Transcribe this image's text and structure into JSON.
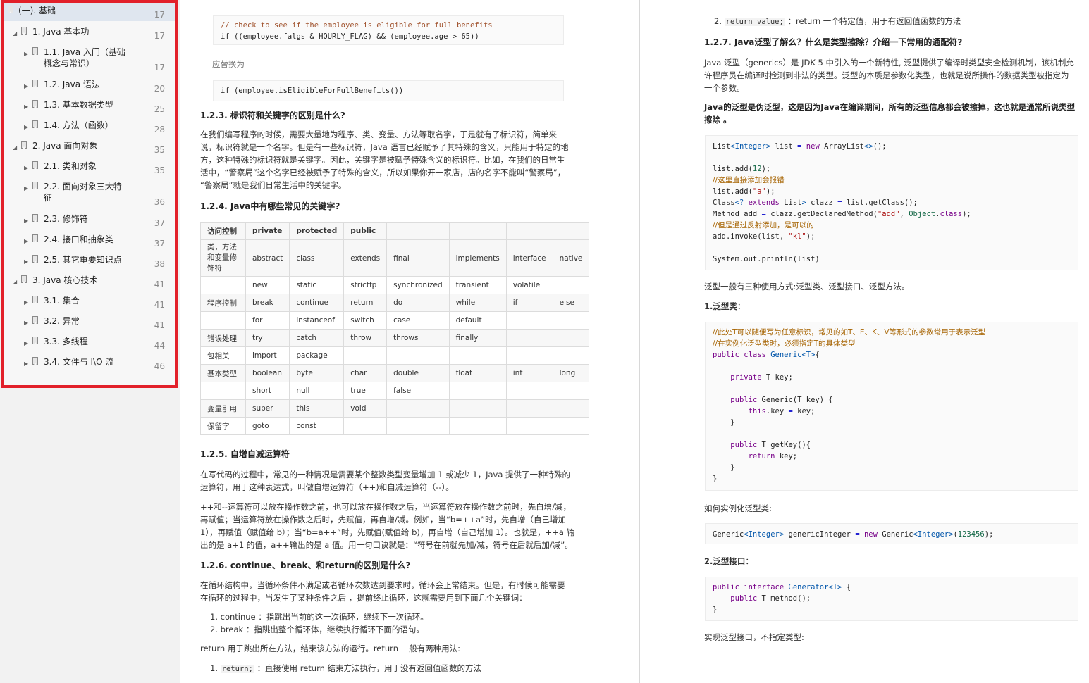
{
  "outline": {
    "items": [
      {
        "label": "(一). 基础",
        "page": "17",
        "level": 0,
        "expanded": true
      },
      {
        "label": "1. Java 基本功",
        "page": "17",
        "level": 1,
        "expanded": true
      },
      {
        "label": "1.1. Java 入门（基础",
        "label2": "概念与常识）",
        "page": "17",
        "level": 2
      },
      {
        "label": "1.2. Java 语法",
        "page": "20",
        "level": 2
      },
      {
        "label": "1.3. 基本数据类型",
        "page": "25",
        "level": 2
      },
      {
        "label": "1.4. 方法（函数）",
        "page": "28",
        "level": 2
      },
      {
        "label": "2. Java 面向对象",
        "page": "35",
        "level": 1,
        "expanded": true
      },
      {
        "label": "2.1. 类和对象",
        "page": "35",
        "level": 2
      },
      {
        "label": "2.2. 面向对象三大特",
        "label2": "征",
        "page": "36",
        "level": 2
      },
      {
        "label": "2.3. 修饰符",
        "page": "37",
        "level": 2
      },
      {
        "label": "2.4. 接口和抽象类",
        "page": "37",
        "level": 2
      },
      {
        "label": "2.5. 其它重要知识点",
        "page": "38",
        "level": 2
      },
      {
        "label": "3. Java 核心技术",
        "page": "41",
        "level": 1,
        "expanded": true
      },
      {
        "label": "3.1. 集合",
        "page": "41",
        "level": 2
      },
      {
        "label": "3.2. 异常",
        "page": "41",
        "level": 2
      },
      {
        "label": "3.3. 多线程",
        "page": "44",
        "level": 2
      },
      {
        "label": "3.4. 文件与 I\\O 流",
        "page": "46",
        "level": 2
      }
    ]
  },
  "left": {
    "code1_comment": "// check to see if the employee is eligible for full benefits",
    "code1_line2": "if ((employee.falgs & HOURLY_FLAG) && (employee.age > 65))",
    "replace_label": "应替换为",
    "code2": "if (employee.isEligibleForFullBenefits())",
    "h123": "1.2.3. 标识符和关键字的区别是什么?",
    "p123": [
      "在我们编写程序的时候，需要大量地为程序、类、变量、方法等取名字，于是就有了标识符，简单来",
      "说，标识符就是一个名字。但是有一些标识符，Java 语言已经赋予了其特殊的含义，只能用于特定的地",
      "方，这种特殊的标识符就是关键字。因此，关键字是被赋予特殊含义的标识符。比如，在我们的日常生",
      "活中，“警察局”这个名字已经被赋予了特殊的含义，所以如果你开一家店，店的名字不能叫“警察局”，",
      "“警察局”就是我们日常生活中的关键字。"
    ],
    "h124": "1.2.4. Java中有哪些常见的关键字?",
    "table": [
      [
        "访问控制",
        "private",
        "protected",
        "public",
        "",
        "",
        "",
        ""
      ],
      [
        "类，方法|和变量修|饰符",
        "abstract",
        "class",
        "extends",
        "final",
        "implements",
        "interface",
        "native"
      ],
      [
        "",
        "new",
        "static",
        "strictfp",
        "synchronized",
        "transient",
        "volatile",
        ""
      ],
      [
        "程序控制",
        "break",
        "continue",
        "return",
        "do",
        "while",
        "if",
        "else"
      ],
      [
        "",
        "for",
        "instanceof",
        "switch",
        "case",
        "default",
        "",
        ""
      ],
      [
        "错误处理",
        "try",
        "catch",
        "throw",
        "throws",
        "finally",
        "",
        ""
      ],
      [
        "包相关",
        "import",
        "package",
        "",
        "",
        "",
        "",
        ""
      ],
      [
        "基本类型",
        "boolean",
        "byte",
        "char",
        "double",
        "float",
        "int",
        "long"
      ],
      [
        "",
        "short",
        "null",
        "true",
        "false",
        "",
        "",
        ""
      ],
      [
        "变量引用",
        "super",
        "this",
        "void",
        "",
        "",
        "",
        ""
      ],
      [
        "保留字",
        "goto",
        "const",
        "",
        "",
        "",
        "",
        ""
      ]
    ],
    "h125": "1.2.5. 自增自减运算符",
    "p125a": [
      "在写代码的过程中，常见的一种情况是需要某个整数类型变量增加 1 或减少 1，Java 提供了一种特殊的",
      "运算符，用于这种表达式，叫做自增运算符（++)和自减运算符（--）。"
    ],
    "p125b": [
      "++和--运算符可以放在操作数之前，也可以放在操作数之后，当运算符放在操作数之前时，先自增/减，",
      "再赋值；当运算符放在操作数之后时，先赋值，再自增/减。例如，当“b=++a”时，先自增（自己增加",
      "1），再赋值（赋值给 b）；当“b=a++”时，先赋值(赋值给 b)，再自增（自己增加 1）。也就是，++a 输",
      "出的是 a+1 的值，a++输出的是 a 值。用一句口诀就是：“符号在前就先加/减，符号在后就后加/减”。"
    ],
    "h126": "1.2.6. continue、break、和return的区别是什么?",
    "p126": [
      "在循环结构中，当循环条件不满足或者循环次数达到要求时，循环会正常结束。但是，有时候可能需要",
      "在循环的过程中，当发生了某种条件之后 ，提前终止循环，这就需要用到下面几个关键词："
    ],
    "li1": "1. continue ：指跳出当前的这一次循环，继续下一次循环。",
    "li2": "2. break ：指跳出整个循环体，继续执行循环下面的语句。",
    "p_return": "return 用于跳出所在方法，结束该方法的运行。return 一般有两种用法:",
    "li_return1_pre": "1.",
    "li_return1_code": "return;",
    "li_return1_text": "：直接使用 return 结束方法执行，用于没有返回值函数的方法"
  },
  "right": {
    "li_return2_pre": "2.",
    "li_return2_code": "return value;",
    "li_return2_text": "：return 一个特定值，用于有返回值函数的方法",
    "h127": "1.2.7. Java泛型了解么？什么是类型擦除？介绍一下常用的通配符?",
    "p127": [
      "Java 泛型（generics）是 JDK 5 中引入的一个新特性, 泛型提供了编译时类型安全检测机制，该机制允",
      "许程序员在编译时检测到非法的类型。泛型的本质是参数化类型，也就是说所操作的数据类型被指定为",
      "一个参数。"
    ],
    "p127bold": [
      "Java的泛型是伪泛型，这是因为Java在编译期间，所有的泛型信息都会被擦掉，这也就是通常所说类型",
      "擦除 。"
    ],
    "generic_usage": "泛型一般有三种使用方式:泛型类、泛型接口、泛型方法。",
    "h_gclass": "1.泛型类",
    "h_gclass_colon": "：",
    "how_instantiate": "如何实例化泛型类:",
    "h_giface": "2.泛型接口",
    "h_giface_colon": "：",
    "impl_iface": "实现泛型接口，不指定类型:",
    "code_comments": {
      "c1": "//这里直接添加会报错",
      "c2": "//但是通过反射添加，是可以的",
      "c3": "//此处T可以随便写为任意标识，常见的如T、E、K、V等形式的参数常用于表示泛型",
      "c4": "//在实例化泛型类时，必须指定T的具体类型"
    }
  }
}
